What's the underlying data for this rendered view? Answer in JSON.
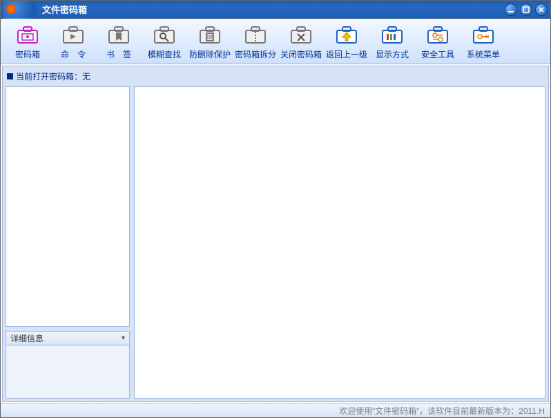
{
  "window": {
    "title": "文件密码箱"
  },
  "toolbar": {
    "items": [
      {
        "label": "密码箱",
        "icon": "safebox-icon",
        "color": "#d020d0"
      },
      {
        "label": "命　令",
        "icon": "command-icon",
        "color": "#666"
      },
      {
        "label": "书　签",
        "icon": "bookmark-icon",
        "color": "#666"
      },
      {
        "label": "模糊查找",
        "icon": "search-icon",
        "color": "#666"
      },
      {
        "label": "防删除保护",
        "icon": "protect-icon",
        "color": "#666"
      },
      {
        "label": "密码箱拆分",
        "icon": "split-icon",
        "color": "#666"
      },
      {
        "label": "关闭密码箱",
        "icon": "close-safebox-icon",
        "color": "#666"
      },
      {
        "label": "返回上一级",
        "icon": "up-arrow-icon",
        "color": "#f0c000"
      },
      {
        "label": "显示方式",
        "icon": "view-mode-icon",
        "color": "#2060c0"
      },
      {
        "label": "安全工具",
        "icon": "security-tools-icon",
        "color": "#2060c0"
      },
      {
        "label": "系统菜单",
        "icon": "system-menu-icon",
        "color": "#2060c0"
      }
    ]
  },
  "content": {
    "current_open_label": "当前打开密码箱：",
    "current_open_value": "无",
    "detail_header": "详细信息"
  },
  "statusbar": {
    "text": "欢迎使用“文件密码箱”，该软件目前最新版本为：2011.H"
  }
}
